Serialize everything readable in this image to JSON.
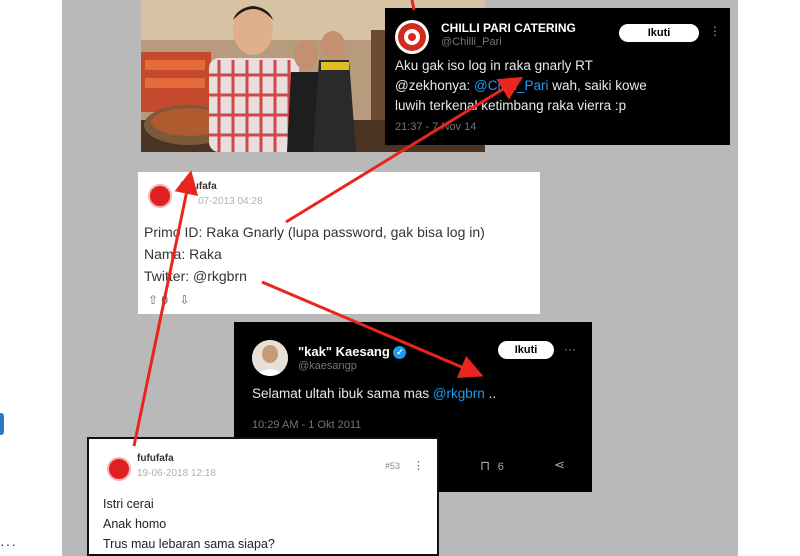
{
  "page": {
    "left_dots": "···",
    "colors": {
      "collage_bg": "#b9b9b9",
      "arrow": "#e8251e",
      "mention": "#1d9bf0",
      "verified": "#1d9bf0"
    }
  },
  "tweet1": {
    "name": "CHILLI PARI CATERING",
    "handle": "@Chilli_Pari",
    "follow_label": "Ikuti",
    "text_line1": "Aku gak iso log in raka gnarly RT",
    "text_line2_prefix": "@zekhonya: ",
    "text_line2_mention": "@Chilli_Pari",
    "text_line2_suffix": " wah, saiki kowe",
    "text_line3": "luwih terkenal ketimbang raka vierra :p",
    "timestamp": "21:37 - 7 Nov 14",
    "avatar_icon": "chilli-pari-logo",
    "more_icon": "more-vertical-icon"
  },
  "forum1": {
    "username": "fufufafa",
    "date": "07-2013 04:28",
    "line1": "Primo ID: Raka Gnarly (lupa password, gak bisa log in)",
    "line2": "Nama: Raka",
    "line3": "Twitter: @rkgbrn",
    "vote_count": "0"
  },
  "tweet2": {
    "name": "\"kak\" Kaesang",
    "handle": "@kaesangp",
    "follow_label": "Ikuti",
    "text_prefix": "Selamat ultah ibuk sama mas ",
    "text_mention": "@rkgbrn",
    "text_suffix": " ..",
    "timestamp": "10:29 AM - 1 Okt 2011",
    "bookmark_count": "6"
  },
  "forum2": {
    "username": "fufufafa",
    "date": "19-06-2018 12:18",
    "post_number": "#53",
    "line1": "Istri cerai",
    "line2": "Anak homo",
    "line3": "Trus mau lebaran sama siapa?"
  }
}
